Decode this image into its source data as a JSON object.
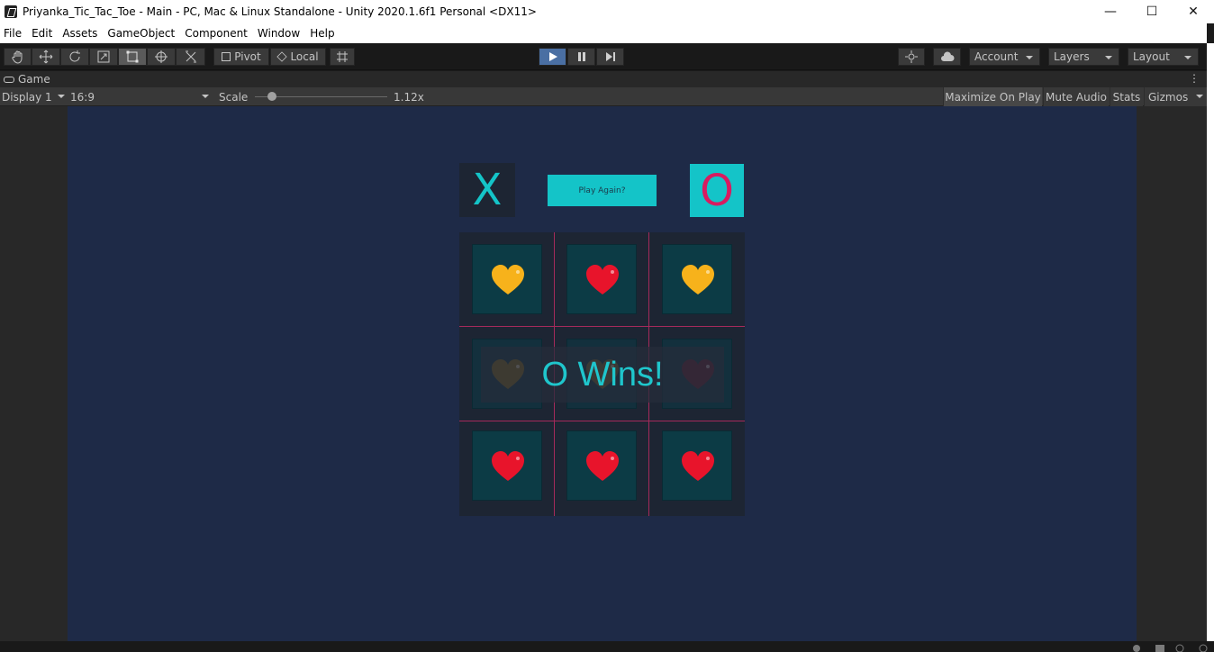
{
  "window": {
    "title": "Priyanka_Tic_Tac_Toe - Main - PC, Mac & Linux Standalone - Unity 2020.1.6f1 Personal <DX11>",
    "controls": {
      "minimize": "—",
      "maximize": "☐",
      "close": "✕"
    }
  },
  "menu": [
    "File",
    "Edit",
    "Assets",
    "GameObject",
    "Component",
    "Window",
    "Help"
  ],
  "toolbar": {
    "tools": [
      "hand-tool-icon",
      "move-tool-icon",
      "rotate-tool-icon",
      "scale-tool-icon",
      "rect-tool-icon",
      "transform-tool-icon",
      "custom-tool-icon"
    ],
    "pivot_label": "Pivot",
    "local_label": "Local",
    "account_label": "Account",
    "layers_label": "Layers",
    "layout_label": "Layout"
  },
  "game_tab": {
    "label": "Game",
    "display_label": "Display 1",
    "aspect_label": "16:9",
    "scale_label": "Scale",
    "scale_value": "1.12x",
    "scale_fraction": 0.1,
    "maximize_label": "Maximize On Play",
    "mute_label": "Mute Audio",
    "stats_label": "Stats",
    "gizmos_label": "Gizmos"
  },
  "game": {
    "x_label": "X",
    "o_label": "O",
    "play_again_label": "Play Again?",
    "win_text": "O Wins!",
    "cells": [
      {
        "color": "#f7b21b",
        "dim": false
      },
      {
        "color": "#e8142b",
        "dim": false
      },
      {
        "color": "#f7b21b",
        "dim": false
      },
      {
        "color": "#7a5d1c",
        "dim": true
      },
      {
        "color": "#6b5a2a",
        "dim": true
      },
      {
        "color": "#5a1b2c",
        "dim": true
      },
      {
        "color": "#e8142b",
        "dim": false
      },
      {
        "color": "#e8142b",
        "dim": false
      },
      {
        "color": "#e8142b",
        "dim": false
      }
    ],
    "colors": {
      "accent": "#14c4c8",
      "o_color": "#d81b60",
      "grid": "#a52a5b",
      "bg": "#1e2a47"
    }
  }
}
